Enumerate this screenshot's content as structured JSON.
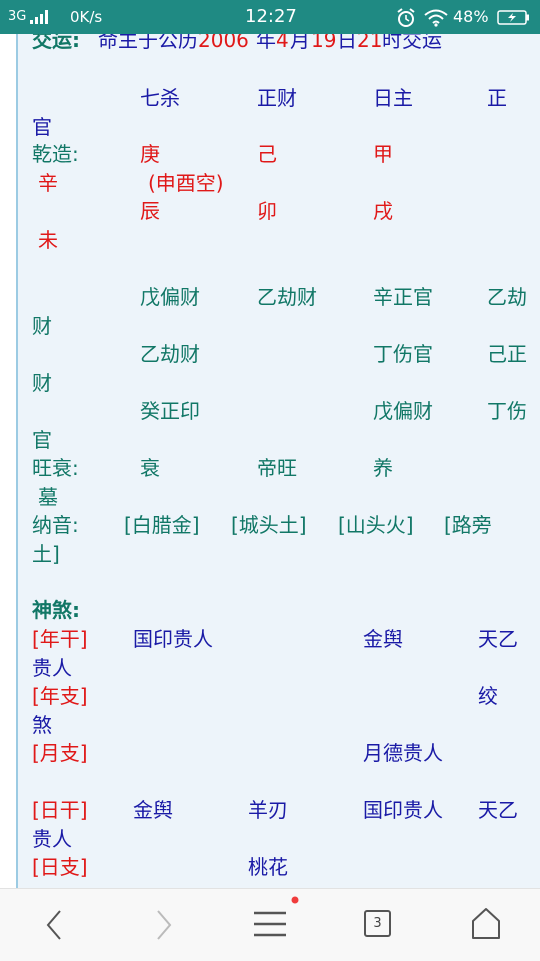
{
  "status_bar": {
    "network": "3G",
    "speed": "0K/s",
    "time": "12:27",
    "battery": "48%"
  },
  "luck_line": {
    "label": "交运:",
    "p1": "命主于公历",
    "year": "2006",
    "p2": "年",
    "month": "4",
    "p3": "月",
    "day": "19",
    "p4": "日",
    "hour": "21",
    "p5": "时交运"
  },
  "ten_gods_row": [
    "七杀",
    "正财",
    "日主",
    "正",
    "官"
  ],
  "qianzao": {
    "label": "乾造:",
    "stems": [
      "庚",
      "己",
      "甲",
      "辛"
    ],
    "kongwang": "(申酉空)",
    "branches": [
      "辰",
      "卯",
      "戌",
      "未"
    ]
  },
  "hidden_stems": {
    "row1": [
      "戊偏财",
      "乙劫财",
      "辛正官",
      "乙劫",
      "财"
    ],
    "row2": [
      "乙劫财",
      "丁伤官",
      "己正",
      "财"
    ],
    "row3": [
      "癸正印",
      "戊偏财",
      "丁伤",
      "官"
    ]
  },
  "wangshuai": {
    "label": "旺衰:",
    "values": [
      "衰",
      "帝旺",
      "养",
      "墓"
    ]
  },
  "nayin": {
    "label": "纳音:",
    "values": [
      "[白腊金]",
      "[城头土]",
      "[山头火]",
      "[路旁",
      "土]"
    ]
  },
  "shensha": {
    "title": "神煞:",
    "nian_gan": {
      "label": "[年干]",
      "c1": "国印贵人",
      "c3": "金舆",
      "c4": "天乙",
      "wrap": "贵人"
    },
    "nian_zhi": {
      "label": "[年支]",
      "c4": "绞",
      "wrap": "煞"
    },
    "yue_zhi": {
      "label": "[月支]",
      "c3": "月德贵人"
    },
    "ri_gan": {
      "label": "[日干]",
      "c1": "金舆",
      "c2": "羊刃",
      "c3": "国印贵人",
      "c4": "天乙",
      "wrap": "贵人"
    },
    "ri_zhi": {
      "label": "[日支]",
      "c2": "桃花"
    }
  },
  "bottom_nav": {
    "tab_count": "3"
  },
  "colors": {
    "status_bar": "#1f8a83",
    "panel_bg": "#edf4fa",
    "blue_text": "#1a1aa6",
    "red_text": "#e01818",
    "green_text": "#117766"
  }
}
